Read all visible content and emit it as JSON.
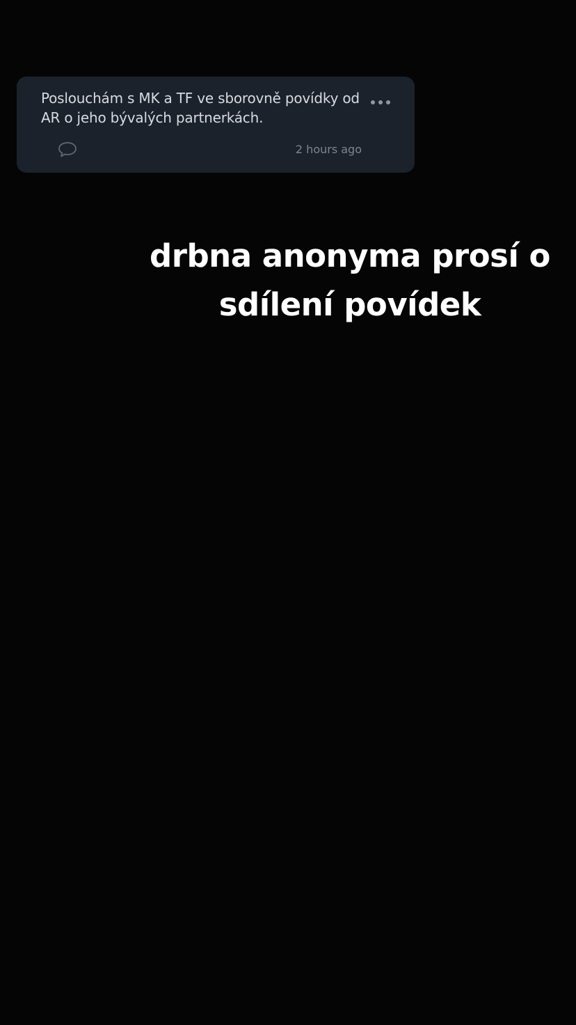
{
  "post": {
    "text": "Poslouchám s MK a TF ve sborovně povídky od AR o jeho bývalých partnerkách.",
    "timestamp": "2 hours ago",
    "more_icon": "more-horizontal-icon",
    "comment_icon": "comment-bubble-icon"
  },
  "caption": {
    "text": "drbna anonyma prosí o sdílení povídek"
  },
  "colors": {
    "background": "#050506",
    "card": "#1c222c",
    "card_text": "#d7dbe1",
    "muted": "#7c8591",
    "caption": "#ffffff"
  }
}
